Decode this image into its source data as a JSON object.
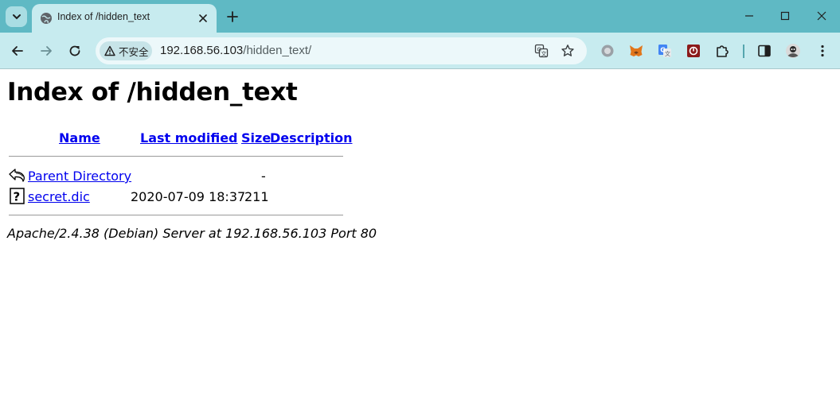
{
  "browser": {
    "tab": {
      "title": "Index of /hidden_text"
    },
    "address_bar": {
      "security_label": "不安全",
      "url_host": "192.168.56.103",
      "url_path": "/hidden_text/"
    },
    "icons": {
      "tab_search": "chevron-down-icon",
      "favicon": "globe-icon",
      "translate": "translate-icon",
      "bookmark": "star-icon",
      "extensions": [
        "circle-extension-icon",
        "metamask-fox-icon",
        "google-translate-icon",
        "red-square-extension-icon",
        "puzzle-icon"
      ],
      "side_panel": "side-panel-icon",
      "profile": "avatar",
      "menu": "kebab-menu-icon"
    },
    "colors": {
      "tabstrip": "#5fb9c4",
      "toolbar": "#c7ebef",
      "link": "#0000ee"
    }
  },
  "page": {
    "title": "Index of /hidden_text",
    "columns": {
      "name": "Name",
      "last_modified": "Last modified",
      "size": "Size",
      "description": "Description"
    },
    "rows": [
      {
        "icon": "back-arrow-icon",
        "name": "Parent Directory",
        "last_modified": "",
        "size": "-",
        "description": ""
      },
      {
        "icon": "unknown-file-icon",
        "name": "secret.dic",
        "last_modified": "2020-07-09 18:37",
        "size": "211",
        "description": ""
      }
    ],
    "server_signature": "Apache/2.4.38 (Debian) Server at 192.168.56.103 Port 80"
  }
}
